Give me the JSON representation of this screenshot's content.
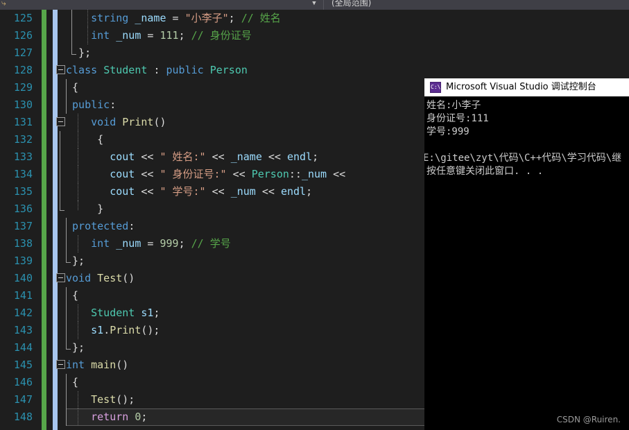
{
  "navbar": {
    "icon": "code-nav-icon",
    "caret": "▼",
    "scope": "(全局范围)"
  },
  "editor": {
    "first_line_number": 125,
    "current_line_number": 148,
    "gutter_colors": {
      "saved_change": "#57a64a",
      "unsaved_marker": "#a8c6ee"
    },
    "lines": [
      {
        "num": "125",
        "text": "        string _name = \"小李子\"; // 姓名"
      },
      {
        "num": "126",
        "text": "        int _num = 111; // 身份证号"
      },
      {
        "num": "127",
        "text": "    };"
      },
      {
        "num": "128",
        "text": "class Student : public Person"
      },
      {
        "num": "129",
        "text": "    {"
      },
      {
        "num": "130",
        "text": "    public:"
      },
      {
        "num": "131",
        "text": "        void Print()"
      },
      {
        "num": "132",
        "text": "        {"
      },
      {
        "num": "133",
        "text": "            cout << \" 姓名:\" << _name << endl;"
      },
      {
        "num": "134",
        "text": "            cout << \" 身份证号:\" << Person::_num <<"
      },
      {
        "num": "135",
        "text": "            cout << \" 学号:\" << _num << endl;"
      },
      {
        "num": "136",
        "text": "        }"
      },
      {
        "num": "137",
        "text": "    protected:"
      },
      {
        "num": "138",
        "text": "        int _num = 999; // 学号"
      },
      {
        "num": "139",
        "text": "    };"
      },
      {
        "num": "140",
        "text": "void Test()"
      },
      {
        "num": "141",
        "text": "    {"
      },
      {
        "num": "142",
        "text": "        Student s1;"
      },
      {
        "num": "143",
        "text": "        s1.Print();"
      },
      {
        "num": "144",
        "text": "    };"
      },
      {
        "num": "145",
        "text": "int main()"
      },
      {
        "num": "146",
        "text": "    {"
      },
      {
        "num": "147",
        "text": "        Test();"
      },
      {
        "num": "148",
        "text": "        return 0;"
      }
    ]
  },
  "console": {
    "title": "Microsoft Visual Studio 调试控制台",
    "icon": "console-cmd-icon",
    "icon_glyph": "C:\\",
    "output": [
      "姓名:小李子",
      "身份证号:111",
      "学号:999",
      "",
      "E:\\gitee\\zyt\\代码\\C++代码\\学习代码\\继",
      "按任意键关闭此窗口. . ."
    ]
  },
  "watermark": {
    "text": "CSDN @Ruiren."
  }
}
